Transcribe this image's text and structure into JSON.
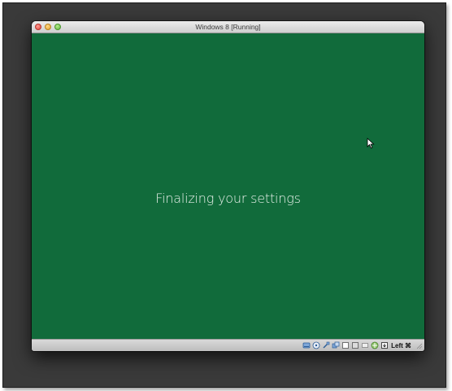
{
  "window": {
    "title": "Windows 8 [Running]"
  },
  "screen": {
    "message": "Finalizing your settings",
    "background_color": "#116b3b"
  },
  "statusbar": {
    "icons": [
      "hard-disk-icon",
      "optical-drive-icon",
      "usb-icon",
      "shared-folders-icon",
      "network-icon",
      "display-icon",
      "video-capture-icon",
      "mouse-integration-icon",
      "keyboard-capture-icon"
    ],
    "host_key_label": "Left ⌘"
  }
}
